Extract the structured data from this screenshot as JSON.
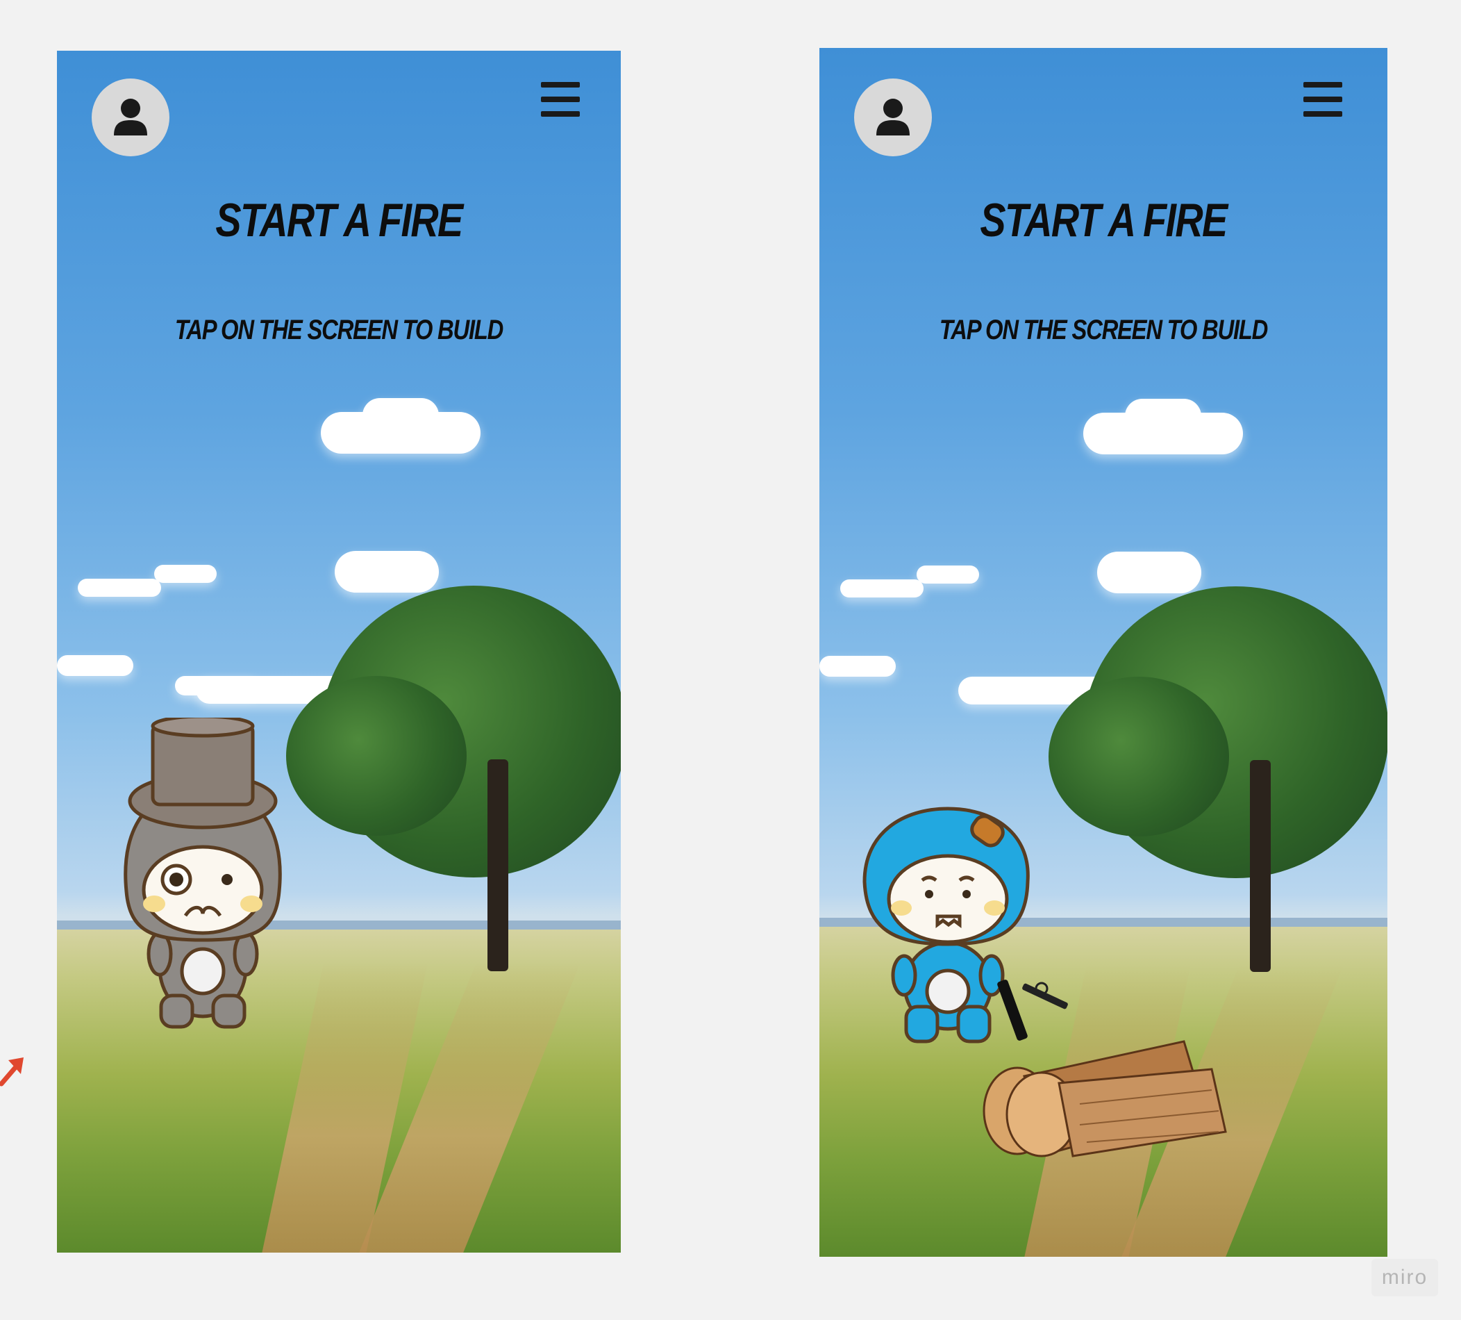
{
  "screens": [
    {
      "title": "START A FIRE",
      "subtitle": "TAP ON THE SCREEN TO BUILD",
      "icons": {
        "profile": "user-icon",
        "menu": "hamburger-menu-icon"
      },
      "character": "gray-top-hat-mascot"
    },
    {
      "title": "START A FIRE",
      "subtitle": "TAP ON THE SCREEN TO BUILD",
      "icons": {
        "profile": "user-icon",
        "menu": "hamburger-menu-icon"
      },
      "character": "blue-hooded-mascot",
      "props": [
        "firewood-logs",
        "fire-starter-tool"
      ]
    }
  ],
  "watermark": "miro",
  "colors": {
    "sky": "#4a97da",
    "grass": "#8fae45",
    "text": "#0d0d0d",
    "accent_arrow": "#e0482f"
  }
}
